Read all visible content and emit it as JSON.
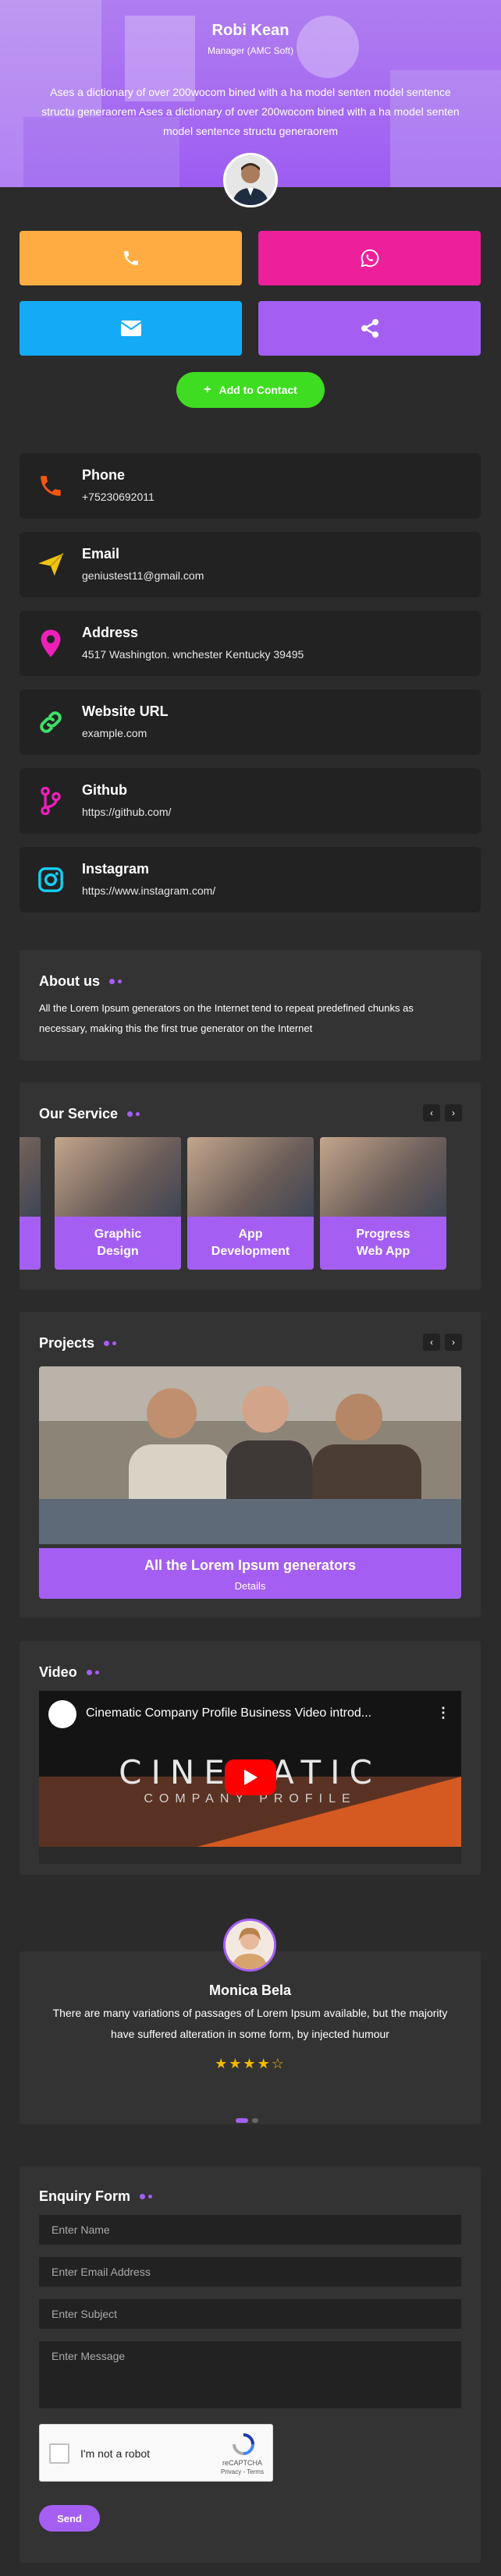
{
  "profile": {
    "name": "Robi Kean",
    "role": "Manager (AMC Soft)",
    "description": "Ases a dictionary of over 200wocom bined with a ha model senten model sentence structu generaorem Ases a dictionary of over 200wocom bined with a ha model senten model sentence structu generaorem"
  },
  "actions": {
    "add_contact_label": "Add to Contact",
    "phone_color": "#ffad42",
    "whatsapp_color": "#ee1f9b",
    "email_color": "#14aaf5",
    "share_color": "#a45ff2"
  },
  "contacts": [
    {
      "title": "Phone",
      "value": "+75230692011",
      "icon": "phone-icon",
      "color": "#f4550f"
    },
    {
      "title": "Email",
      "value": "geniustest11@gmail.com",
      "icon": "send-icon",
      "color": "#f1c40f"
    },
    {
      "title": "Address",
      "value": "4517 Washington. wnchester Kentucky 39495",
      "icon": "map-pin-icon",
      "color": "#ee1fb8"
    },
    {
      "title": "Website URL",
      "value": "example.com",
      "icon": "link-icon",
      "color": "#3ee06a"
    },
    {
      "title": "Github",
      "value": "https://github.com/",
      "icon": "branch-icon",
      "color": "#ee1fb8"
    },
    {
      "title": "Instagram",
      "value": "https://www.instagram.com/",
      "icon": "instagram-icon",
      "color": "#14d0f5"
    }
  ],
  "about": {
    "title": "About us",
    "text": "All the Lorem Ipsum generators on the Internet tend to repeat predefined chunks as necessary, making this the first true generator on the Internet"
  },
  "services": {
    "title": "Our Service",
    "items": [
      "Graphic Design",
      "App Development",
      "Progress Web App"
    ]
  },
  "projects": {
    "title": "Projects",
    "card_title": "All the Lorem Ipsum generators",
    "card_link": "Details"
  },
  "video": {
    "title": "Video",
    "video_title": "Cinematic Company Profile Business Video introd...",
    "overlay_line1": "CINEMATIC",
    "overlay_line2": "COMPANY PROFILE"
  },
  "testimonial": {
    "name": "Monica Bela",
    "text": "There are many variations of passages of Lorem Ipsum available, but the majority have suffered alteration in some form, by injected humour",
    "stars": "★★★★☆",
    "rating": 4
  },
  "enquiry": {
    "title": "Enquiry Form",
    "name_placeholder": "Enter Name",
    "email_placeholder": "Enter Email Address",
    "subject_placeholder": "Enter Subject",
    "message_placeholder": "Enter Message",
    "captcha_label": "I'm not a robot",
    "captcha_brand": "reCAPTCHA",
    "captcha_terms": "Privacy - Terms",
    "send_label": "Send"
  }
}
